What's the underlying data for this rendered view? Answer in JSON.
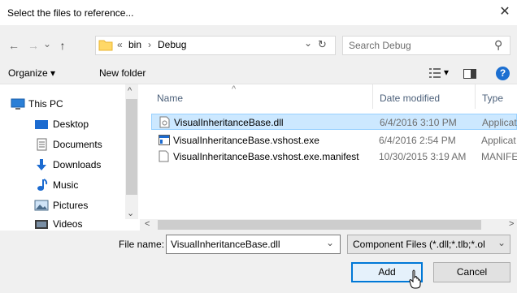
{
  "window": {
    "title": "Select the files to reference...",
    "close_glyph": "✕"
  },
  "nav": {
    "back_glyph": "←",
    "forward_glyph": "→",
    "recent_glyph": "⌄",
    "up_glyph": "↑",
    "breadcrumb": {
      "overflow": "«",
      "parts": [
        "bin",
        "Debug"
      ],
      "separator": "›"
    },
    "dropdown_glyph": "⌄",
    "refresh_glyph": "↻",
    "search_placeholder": "Search Debug",
    "search_glyph": "⚲"
  },
  "toolbar": {
    "organize_label": "Organize ▾",
    "new_folder_label": "New folder",
    "view_glyph": "▾",
    "help_glyph": "?"
  },
  "sidebar": {
    "items": [
      {
        "label": "This PC",
        "icon": "computer-icon"
      },
      {
        "label": "Desktop",
        "icon": "desktop-icon"
      },
      {
        "label": "Documents",
        "icon": "documents-icon"
      },
      {
        "label": "Downloads",
        "icon": "downloads-icon"
      },
      {
        "label": "Music",
        "icon": "music-icon"
      },
      {
        "label": "Pictures",
        "icon": "pictures-icon"
      },
      {
        "label": "Videos",
        "icon": "videos-icon"
      }
    ]
  },
  "files": {
    "columns": [
      "Name",
      "Date modified",
      "Type"
    ],
    "sort_glyph": "^",
    "rows": [
      {
        "name": "VisualInheritanceBase.dll",
        "date": "6/4/2016 3:10 PM",
        "type": "Applicat",
        "icon": "dll-file-icon",
        "selected": true
      },
      {
        "name": "VisualInheritanceBase.vshost.exe",
        "date": "6/4/2016 2:54 PM",
        "type": "Applicat",
        "icon": "exe-file-icon",
        "selected": false
      },
      {
        "name": "VisualInheritanceBase.vshost.exe.manifest",
        "date": "10/30/2015 3:19 AM",
        "type": "MANIFE",
        "icon": "manifest-file-icon",
        "selected": false
      }
    ]
  },
  "footer": {
    "file_name_label": "File name:",
    "file_name_value": "VisualInheritanceBase.dll",
    "filter_value": "Component Files (*.dll;*.tlb;*.ol",
    "add_label": "Add",
    "cancel_label": "Cancel"
  },
  "scroll": {
    "up_glyph": "^",
    "down_glyph": "⌄",
    "left_glyph": "<",
    "right_glyph": ">"
  }
}
